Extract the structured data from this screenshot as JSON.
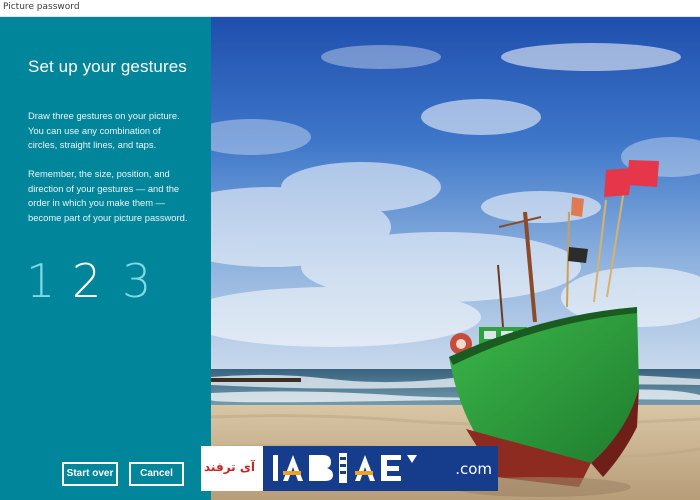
{
  "window": {
    "title": "Picture password"
  },
  "panel": {
    "heading": "Set up your gestures",
    "instructions": "Draw three gestures on your picture. You can use any combination of circles, straight lines, and taps.",
    "remember": "Remember, the size, position, and direction of your gestures — and the order in which you make them — become part of your picture password.",
    "steps": [
      "1",
      "2",
      "3"
    ],
    "active_step": 2,
    "buttons": {
      "start_over": "Start over",
      "cancel": "Cancel"
    },
    "colors": {
      "panel_bg": "#00859a",
      "step_inactive": "#7fd8e6",
      "step_active": "#ffffff"
    }
  },
  "picture": {
    "icon": "beach-boat-photo"
  },
  "watermark": {
    "persian_text": "آی ترفند",
    "domain": ".com"
  }
}
